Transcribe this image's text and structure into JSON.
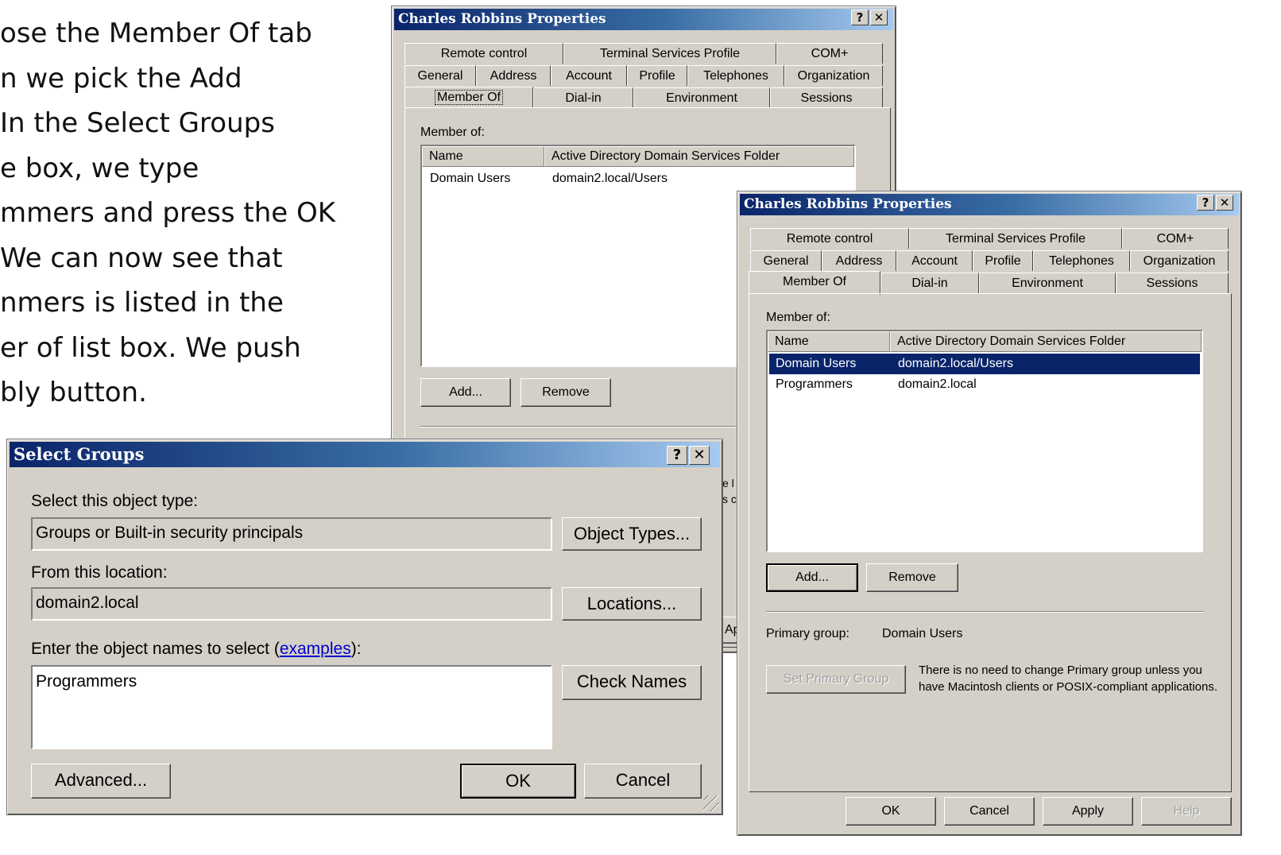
{
  "caption": {
    "lines": [
      "ose the Member Of tab",
      "n we pick the Add",
      " In the Select Groups",
      "e box, we type",
      "mmers and press the OK",
      " We can now see that",
      "nmers is listed in the",
      "er of list box. We push",
      "bly button."
    ]
  },
  "back_window": {
    "title": "Charles Robbins Properties",
    "tabs_row1": [
      "Remote control",
      "Terminal Services Profile",
      "COM+"
    ],
    "tabs_row2": [
      "General",
      "Address",
      "Account",
      "Profile",
      "Telephones",
      "Organization"
    ],
    "tabs_row3": [
      "Member Of",
      "Dial-in",
      "Environment",
      "Sessions"
    ],
    "member_of_label": "Member of:",
    "columns": [
      "Name",
      "Active Directory Domain Services Folder"
    ],
    "rows": [
      {
        "name": "Domain Users",
        "folder": "domain2.local/Users"
      }
    ],
    "add_button": "Add...",
    "remove_button": "Remove",
    "partial_text_1": "e l",
    "partial_text_2": "s c",
    "partial_button": "Ap"
  },
  "front_window": {
    "title": "Charles Robbins Properties",
    "tabs_row1": [
      "Remote control",
      "Terminal Services Profile",
      "COM+"
    ],
    "tabs_row2": [
      "General",
      "Address",
      "Account",
      "Profile",
      "Telephones",
      "Organization"
    ],
    "tabs_row3": [
      "Member Of",
      "Dial-in",
      "Environment",
      "Sessions"
    ],
    "member_of_label": "Member of:",
    "columns": [
      "Name",
      "Active Directory Domain Services Folder"
    ],
    "rows": [
      {
        "name": "Domain Users",
        "folder": "domain2.local/Users",
        "selected": true
      },
      {
        "name": "Programmers",
        "folder": "domain2.local",
        "selected": false
      }
    ],
    "add_button": "Add...",
    "remove_button": "Remove",
    "primary_group_label": "Primary group:",
    "primary_group_value": "Domain Users",
    "set_primary_button": "Set Primary Group",
    "primary_note": "There is no need to change Primary group unless you have Macintosh clients or POSIX-compliant applications.",
    "ok_button": "OK",
    "cancel_button": "Cancel",
    "apply_button": "Apply",
    "help_button": "Help"
  },
  "select_groups": {
    "title": "Select Groups",
    "object_type_label": "Select this object type:",
    "object_type_value": "Groups or Built-in security principals",
    "object_types_button": "Object Types...",
    "location_label": "From this location:",
    "location_value": "domain2.local",
    "locations_button": "Locations...",
    "names_label_pre": "Enter the object names to select (",
    "names_label_link": "examples",
    "names_label_post": "):",
    "names_value": "Programmers",
    "check_names_button": "Check Names",
    "advanced_button": "Advanced...",
    "ok_button": "OK",
    "cancel_button": "Cancel"
  },
  "colors": {
    "title_start": "#0a246a",
    "title_end": "#a6caf0",
    "face": "#d4d0c8",
    "selection": "#0a246a",
    "link": "#0000cc"
  }
}
